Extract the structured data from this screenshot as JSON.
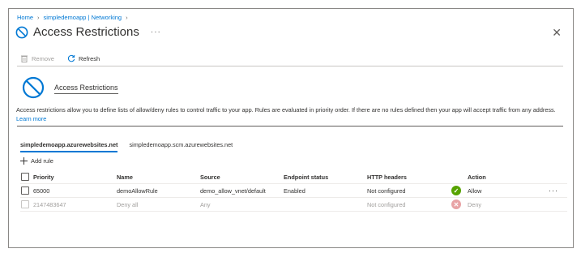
{
  "breadcrumb": [
    "Home",
    "simpledemoapp | Networking"
  ],
  "page": {
    "title": "Access Restrictions",
    "ellipsis": "···",
    "close": "✕"
  },
  "toolbar": {
    "remove_label": "Remove",
    "refresh_label": "Refresh"
  },
  "hero": {
    "title": "Access Restrictions"
  },
  "description": {
    "text": "Access restrictions allow you to define lists of allow/deny rules to control traffic to your app. Rules are evaluated in priority order. If there are no rules defined then your app will accept traffic from any address.",
    "link": "Learn more"
  },
  "tabs": [
    "simpledemoapp.azurewebsites.net",
    "simpledemoapp.scm.azurewebsites.net"
  ],
  "add_rule_label": "Add rule",
  "table": {
    "headers": [
      "Priority",
      "Name",
      "Source",
      "Endpoint status",
      "HTTP headers",
      "Action"
    ],
    "rows": [
      {
        "priority": "65000",
        "name": "demoAllowRule",
        "source": "demo_allow_vnet/default",
        "endpoint": "Enabled",
        "http": "Not configured",
        "action": "Allow",
        "status_icon": "check-icon",
        "more": "···"
      },
      {
        "priority": "2147483647",
        "name": "Deny all",
        "source": "Any",
        "endpoint": "",
        "http": "Not configured",
        "action": "Deny",
        "status_icon": "x-icon"
      }
    ]
  },
  "colors": {
    "accent": "#0078d4",
    "allow": "#57a300",
    "deny": "#e8a3a5"
  }
}
